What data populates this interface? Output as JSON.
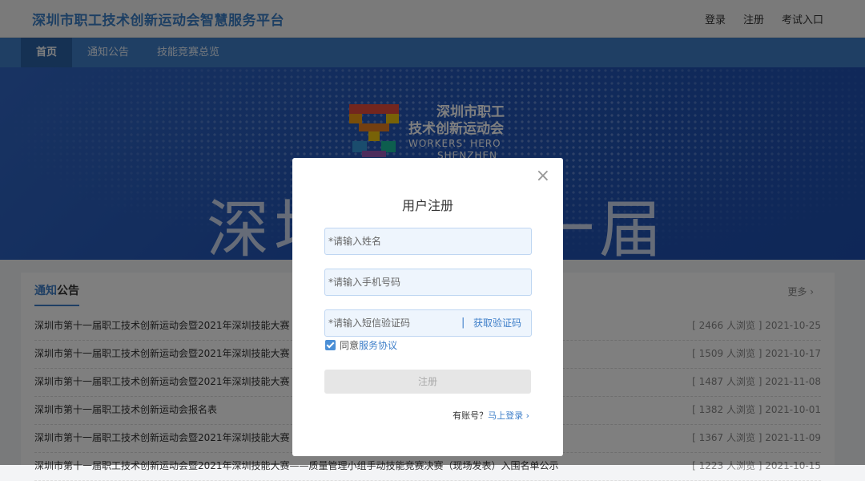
{
  "header": {
    "site_title": "深圳市职工技术创新运动会智慧服务平台",
    "links": [
      "登录",
      "注册",
      "考试入口"
    ]
  },
  "nav": {
    "items": [
      {
        "label": "首页",
        "active": true
      },
      {
        "label": "通知公告",
        "active": false
      },
      {
        "label": "技能竞赛总览",
        "active": false
      }
    ]
  },
  "banner": {
    "logo_cn_line1": "深圳市职工",
    "logo_cn_line2": "技术创新运动会",
    "logo_en_line1": "WORKERS' HERO",
    "logo_en_line2": "SHENZHEN",
    "big_text_left": "深圳",
    "big_text_right": "一届"
  },
  "notices": {
    "title_highlight": "通知",
    "title_rest": "公告",
    "more": "更多 ›",
    "rows": [
      {
        "title": "深圳市第十一届职工技术创新运动会暨2021年深圳技能大赛",
        "meta": "[ 2466 人浏览 ] 2021-10-25"
      },
      {
        "title": "深圳市第十一届职工技术创新运动会暨2021年深圳技能大赛",
        "meta": "[ 1509 人浏览 ] 2021-10-17"
      },
      {
        "title": "深圳市第十一届职工技术创新运动会暨2021年深圳技能大赛",
        "meta": "[ 1487 人浏览 ] 2021-11-08"
      },
      {
        "title": "深圳市第十一届职工技术创新运动会报名表",
        "meta": "[ 1382 人浏览 ] 2021-10-01"
      },
      {
        "title": "深圳市第十一届职工技术创新运动会暨2021年深圳技能大赛",
        "meta": "[ 1367 人浏览 ] 2021-11-09"
      },
      {
        "title": "深圳市第十一届职工技术创新运动会暨2021年深圳技能大赛——质量管理小组手动技能竞赛决赛（现场发表）入围名单公示",
        "meta": "[ 1223 人浏览 ] 2021-10-15"
      }
    ]
  },
  "modal": {
    "close": "×",
    "title": "用户注册",
    "name_placeholder": "*请输入姓名",
    "phone_placeholder": "*请输入手机号码",
    "code_placeholder": "*请输入短信验证码",
    "code_separator": "|",
    "get_code": "获取验证码",
    "agree_text": "同意",
    "agree_link": "服务协议",
    "submit": "注册",
    "have_account": "有账号？",
    "login_link": "马上登录 ›"
  }
}
